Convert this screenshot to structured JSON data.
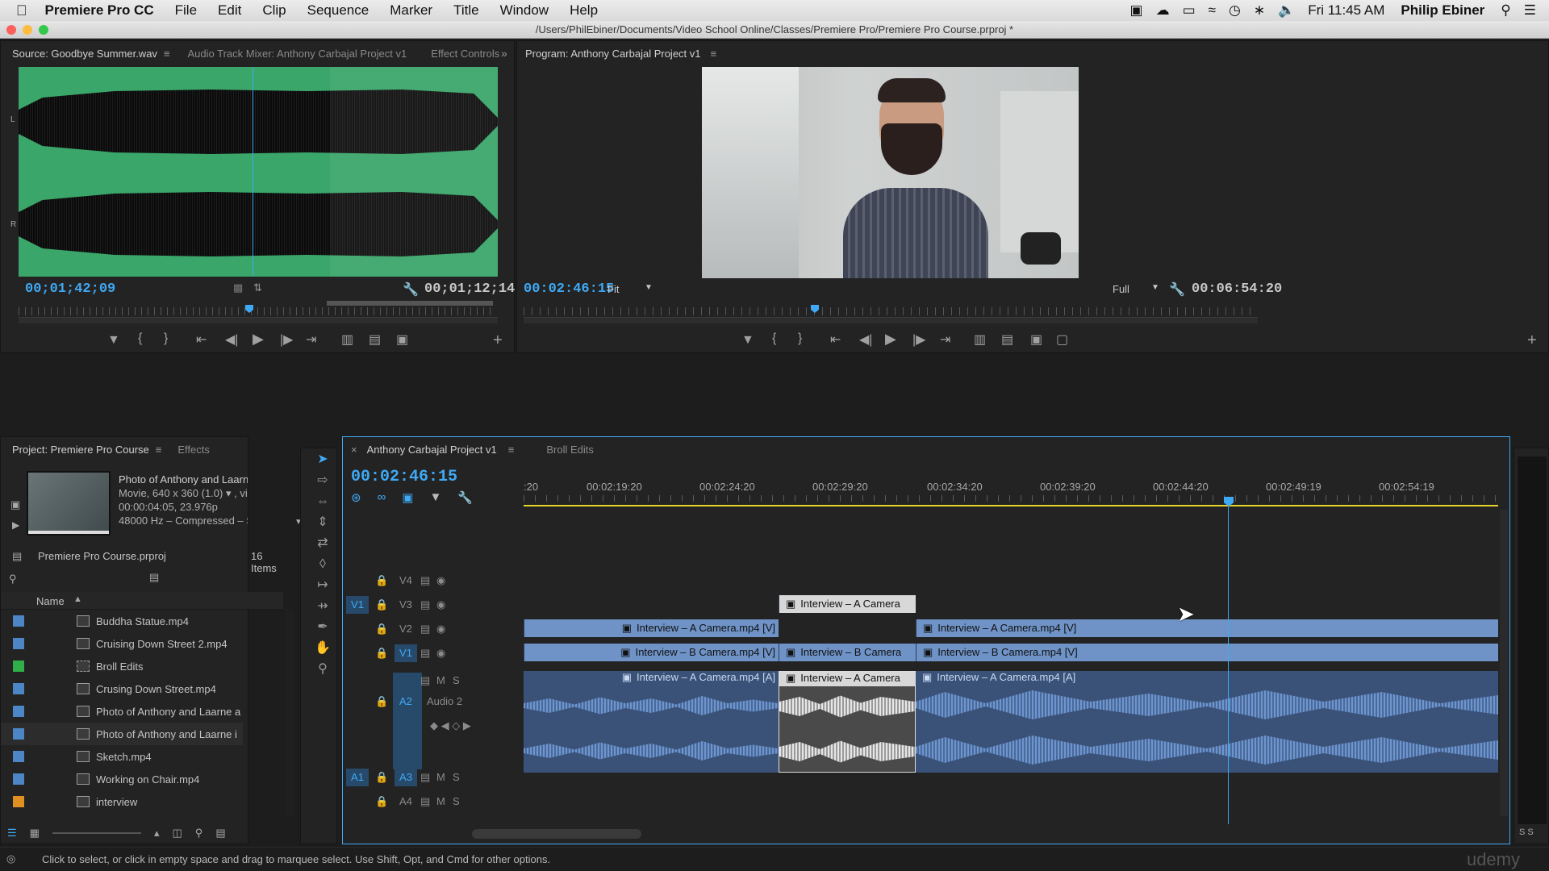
{
  "menubar": {
    "app_name": "Premiere Pro CC",
    "items": [
      "File",
      "Edit",
      "Clip",
      "Sequence",
      "Marker",
      "Title",
      "Window",
      "Help"
    ],
    "clock": "Fri 11:45 AM",
    "user": "Philip Ebiner"
  },
  "window": {
    "title": "/Users/PhilEbiner/Documents/Video School Online/Classes/Premiere Pro/Premiere Pro Course.prproj *"
  },
  "source": {
    "tabs": [
      "Source: Goodbye Summer.wav",
      "Audio Track Mixer: Anthony Carbajal Project v1",
      "Effect Controls"
    ],
    "channel_left": "L",
    "channel_right": "R",
    "timecode_current": "00;01;42;09",
    "timecode_duration": "00;01;12;14"
  },
  "program": {
    "tab": "Program: Anthony Carbajal Project v1",
    "timecode_current": "00:02:46:15",
    "fit": "Fit",
    "resolution": "Full",
    "timecode_duration": "00:06:54:20"
  },
  "project": {
    "tabs": [
      "Project: Premiere Pro Course",
      "Effects"
    ],
    "preview_name": "Photo of Anthony and Laarn...",
    "preview_line1": "Movie, 640 x 360 (1.0) ▾ , vi...",
    "preview_line2": "00:00:04:05, 23.976p",
    "preview_line3": "48000 Hz – Compressed – St...",
    "file_name": "Premiere Pro Course.prproj",
    "item_count": "16 Items",
    "column_name": "Name",
    "items": [
      {
        "name": "Buddha Statue.mp4",
        "color": "#4c86c6"
      },
      {
        "name": "Cruising Down Street 2.mp4",
        "color": "#4c86c6"
      },
      {
        "name": "Broll Edits",
        "color": "#2fae49"
      },
      {
        "name": "Crusing Down Street.mp4",
        "color": "#4c86c6"
      },
      {
        "name": "Photo of Anthony and Laarne a",
        "color": "#4c86c6"
      },
      {
        "name": "Photo of Anthony and Laarne i",
        "color": "#4c86c6"
      },
      {
        "name": "Sketch.mp4",
        "color": "#4c86c6"
      },
      {
        "name": "Working on Chair.mp4",
        "color": "#4c86c6"
      },
      {
        "name": "interview",
        "color": "#e08f23"
      }
    ]
  },
  "timeline": {
    "tabs": [
      "Anthony Carbajal Project v1",
      "Broll Edits"
    ],
    "timecode": "00:02:46:15",
    "ruler": [
      ":20",
      "00:02:19:20",
      "00:02:24:20",
      "00:02:29:20",
      "00:02:34:20",
      "00:02:39:20",
      "00:02:44:20",
      "00:02:49:19",
      "00:02:54:19"
    ],
    "tracks": {
      "v4": "V4",
      "v3": "V3",
      "v2": "V2",
      "v1": "V1",
      "a2": "A2",
      "a3": "A3",
      "a4": "A4",
      "src_v1": "V1",
      "src_a1": "A1",
      "audio2_name": "Audio 2",
      "m": "M",
      "s": "S"
    },
    "clips": {
      "v3_1": "Interview – A Camera",
      "v2_1": "Interview – A Camera.mp4 [V]",
      "v2_2": "Interview – A Camera.mp4 [V]",
      "v1_1": "Interview – B Camera.mp4 [V]",
      "v1_2": "Interview – B Camera",
      "v1_3": "Interview – B Camera.mp4 [V]",
      "a2_1": "Interview – A Camera.mp4 [A]",
      "a2_2": "Interview – A Camera",
      "a2_3": "Interview – A Camera.mp4 [A]"
    },
    "meter_labels": "S S"
  },
  "status": {
    "text": "Click to select, or click in empty space and drag to marquee select. Use Shift, Opt, and Cmd for other options."
  },
  "watermark": "udemy",
  "colors": {
    "accent": "#3fa9f5",
    "video_clip": "#6f93c6",
    "audio_clip": "#3a5278"
  }
}
